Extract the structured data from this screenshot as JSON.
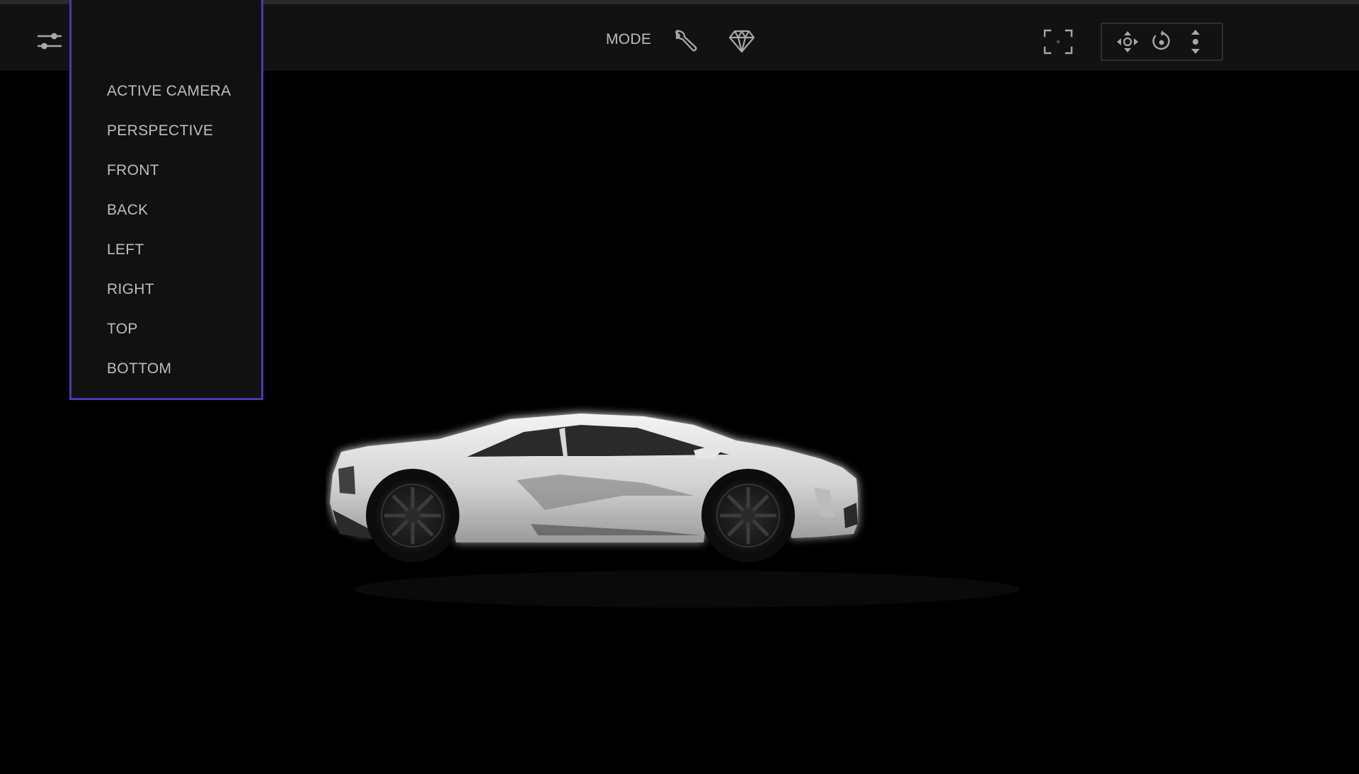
{
  "toolbar": {
    "view_select": {
      "selected": "LEFT",
      "options": [
        "ACTIVE CAMERA",
        "PERSPECTIVE",
        "FRONT",
        "BACK",
        "LEFT",
        "RIGHT",
        "TOP",
        "BOTTOM"
      ]
    },
    "mode_label": "MODE",
    "icons": {
      "settings": "sliders-icon",
      "mode_edit": "wrench-icon",
      "mode_material": "diamond-icon",
      "frame": "frame-icon",
      "pan": "pan-icon",
      "orbit": "orbit-icon",
      "dolly": "dolly-icon"
    }
  },
  "colors": {
    "accent": "#4a3ab0",
    "toolbar_bg": "#121212",
    "viewport_bg": "#000000",
    "text": "#bdbdbd"
  }
}
